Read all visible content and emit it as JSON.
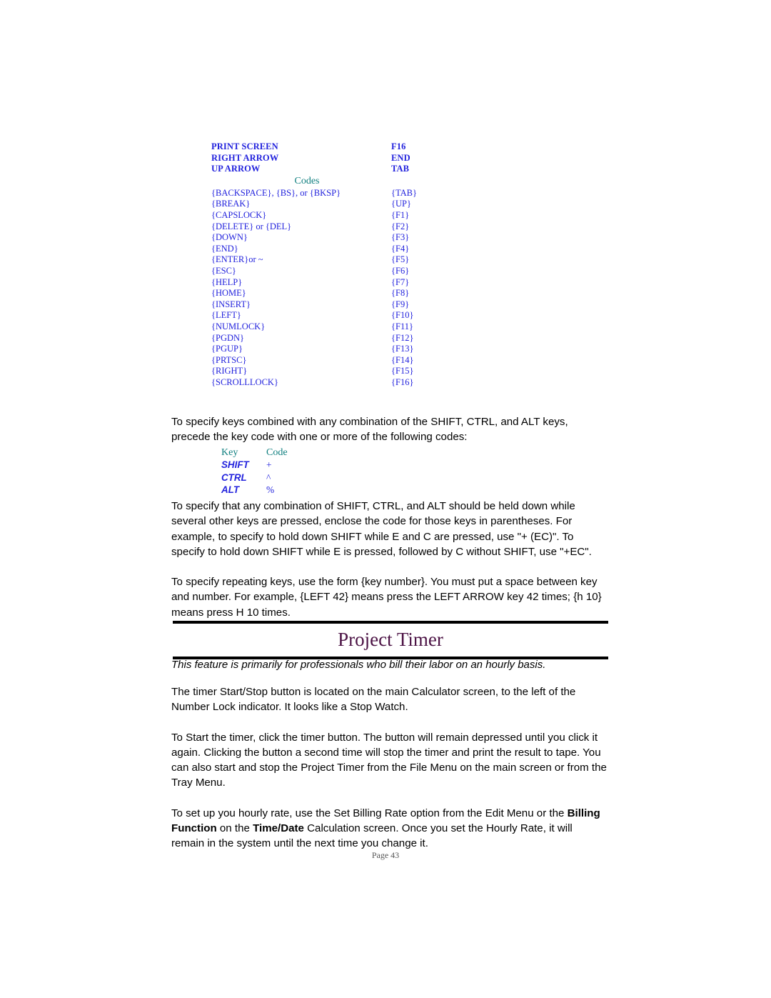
{
  "key_table": {
    "top_rows": [
      {
        "key": "PRINT SCREEN",
        "code": "F16"
      },
      {
        "key": "RIGHT ARROW",
        "code": "END"
      },
      {
        "key": "UP ARROW",
        "code": "TAB"
      }
    ],
    "codes_header": "Codes",
    "code_rows": [
      {
        "key": "{BACKSPACE}, {BS}, or {BKSP}",
        "code": "{TAB}"
      },
      {
        "key": "{BREAK}",
        "code": "{UP}"
      },
      {
        "key": "{CAPSLOCK}",
        "code": "{F1}"
      },
      {
        "key": "{DELETE} or {DEL}",
        "code": "{F2}"
      },
      {
        "key": "{DOWN}",
        "code": "{F3}"
      },
      {
        "key": "{END}",
        "code": "{F4}"
      },
      {
        "key": "{ENTER}or ~",
        "code": "{F5}"
      },
      {
        "key": "{ESC}",
        "code": "{F6}"
      },
      {
        "key": "{HELP}",
        "code": "{F7}"
      },
      {
        "key": "{HOME}",
        "code": "{F8}"
      },
      {
        "key": "{INSERT}",
        "code": "{F9}"
      },
      {
        "key": "{LEFT}",
        "code": "{F10}"
      },
      {
        "key": "{NUMLOCK}",
        "code": "{F11}"
      },
      {
        "key": "{PGDN}",
        "code": "{F12}"
      },
      {
        "key": "{PGUP}",
        "code": "{F13}"
      },
      {
        "key": "{PRTSC}",
        "code": "{F14}"
      },
      {
        "key": "{RIGHT}",
        "code": "{F15}"
      },
      {
        "key": "{SCROLLLOCK}",
        "code": "{F16}"
      }
    ]
  },
  "paragraphs": {
    "modifier_intro": "To specify keys combined with any combination of the SHIFT, CTRL, and ALT keys, precede the key code with one or more of the following codes:",
    "parenthesis_rule": "To specify that any combination of SHIFT, CTRL, and ALT should be held down while several other keys are pressed, enclose the code for those keys in parentheses. For example, to specify to hold down SHIFT while E and C are pressed, use \"+ (EC)\". To specify to hold down SHIFT while E is pressed, followed by C without SHIFT, use \"+EC\".",
    "repeating_keys": "To specify repeating keys, use the form {key number}. You must put a space between key and number. For example, {LEFT 42} means press the LEFT ARROW key 42 times; {h 10} means press H 10 times.",
    "timer_button_location": "The timer Start/Stop button is located on the main Calculator screen, to the left of the Number Lock indicator.  It looks like a Stop Watch.",
    "timer_usage": "To Start the timer, click the timer button.  The button will remain depressed until you click it again.  Clicking the button a second time will stop the timer and print the result to tape.  You can also start and stop the Project Timer from the File Menu on the main screen or from the Tray Menu.",
    "billing_rate_1": "To set up you hourly rate, use the Set Billing Rate option from the Edit Menu or the ",
    "billing_rate_bold_1": "Billing Function",
    "billing_rate_2": " on the ",
    "billing_rate_bold_2": "Time/Date",
    "billing_rate_3": " Calculation screen.  Once you set the Hourly Rate, it will remain in the system until the next time you change it."
  },
  "modifier_table": {
    "header": {
      "key": "Key",
      "code": "Code"
    },
    "rows": [
      {
        "key": "SHIFT",
        "code": "+"
      },
      {
        "key": "CTRL",
        "code": "^"
      },
      {
        "key": "ALT",
        "code": "%"
      }
    ]
  },
  "section": {
    "title": "Project Timer",
    "subtitle": "This feature is primarily for professionals who bill their labor on an hourly basis."
  },
  "footer": {
    "page_label": "Page 43"
  },
  "colors": {
    "key_blue": "#2222dd",
    "teal": "#0f7f7f",
    "heading_purple": "#4b1244",
    "rule_black": "#000000",
    "footer_gray": "#555555"
  }
}
